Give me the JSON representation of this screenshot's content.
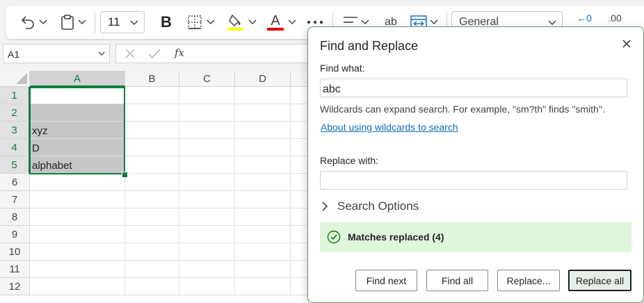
{
  "ribbon": {
    "font_size": "11",
    "number_format": "General",
    "undo_icon": "undo-icon",
    "paste_icon": "paste-icon",
    "bold_label": "B",
    "borders_icon": "borders-icon",
    "fill_color_icon": "fill-color-icon",
    "fill_color": "#ffff00",
    "font_color_label": "A",
    "font_color": "#e00000",
    "more_icon": "more-icon",
    "align_icon": "align-icon",
    "wrap_label": "ab",
    "merge_icon": "merge-icon",
    "decimal_increase_label": "←0",
    "decimal_decrease_label": ".00"
  },
  "formula_bar": {
    "name_box": "A1",
    "fx_label": "fx"
  },
  "sheet": {
    "columns": [
      "A",
      "B",
      "C",
      "D"
    ],
    "rows": [
      "1",
      "2",
      "3",
      "4",
      "5",
      "6",
      "7",
      "8",
      "9",
      "10",
      "11",
      "12"
    ],
    "column_a": [
      "",
      "",
      "xyz",
      "D",
      "alphabet",
      "",
      "",
      "",
      "",
      "",
      "",
      ""
    ],
    "accent": "#107c41"
  },
  "dialog": {
    "title": "Find and Replace",
    "find_label": "Find what:",
    "find_value": "abc",
    "hint": "Wildcards can expand search. For example, \"sm?th\" finds \"smith\".",
    "link": "About using wildcards to search",
    "replace_label": "Replace with:",
    "replace_value": "",
    "search_options": "Search Options",
    "status": "Matches replaced (4)",
    "status_color": "#dff6dd",
    "buttons": {
      "find_next": "Find next",
      "find_all": "Find all",
      "replace": "Replace...",
      "replace_all": "Replace all"
    }
  }
}
